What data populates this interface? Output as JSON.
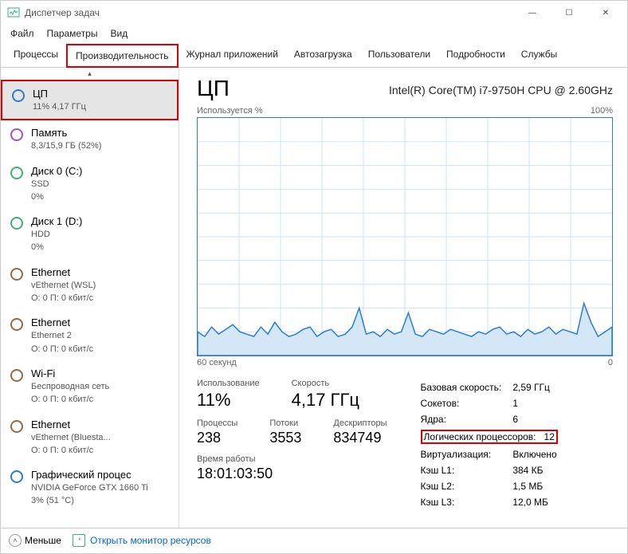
{
  "window": {
    "title": "Диспетчер задач"
  },
  "menu": {
    "file": "Файл",
    "options": "Параметры",
    "view": "Вид"
  },
  "tabs": {
    "processes": "Процессы",
    "performance": "Производительность",
    "apphistory": "Журнал приложений",
    "startup": "Автозагрузка",
    "users": "Пользователи",
    "details": "Подробности",
    "services": "Службы"
  },
  "sidebar": {
    "cpu": {
      "label": "ЦП",
      "sub": "11% 4,17 ГГц"
    },
    "memory": {
      "label": "Память",
      "sub": "8,3/15,9 ГБ (52%)"
    },
    "disk0": {
      "label": "Диск 0 (C:)",
      "sub1": "SSD",
      "sub2": "0%"
    },
    "disk1": {
      "label": "Диск 1 (D:)",
      "sub1": "HDD",
      "sub2": "0%"
    },
    "eth1": {
      "label": "Ethernet",
      "sub1": "vEthernet (WSL)",
      "sub2": "О: 0 П: 0 кбит/с"
    },
    "eth2": {
      "label": "Ethernet",
      "sub1": "Ethernet 2",
      "sub2": "О: 0 П: 0 кбит/с"
    },
    "wifi": {
      "label": "Wi-Fi",
      "sub1": "Беспроводная сеть",
      "sub2": "О: 0 П: 0 кбит/с"
    },
    "eth3": {
      "label": "Ethernet",
      "sub1": "vEthernet (Bluesta...",
      "sub2": "О: 0 П: 0 кбит/с"
    },
    "gpu": {
      "label": "Графический процес",
      "sub1": "NVIDIA GeForce GTX 1660 Ti",
      "sub2": "3% (51 °C)"
    }
  },
  "content": {
    "heading": "ЦП",
    "cpu_name": "Intel(R) Core(TM) i7-9750H CPU @ 2.60GHz",
    "chart_top_left": "Используется %",
    "chart_top_right": "100%",
    "chart_bottom_left": "60 секунд",
    "chart_bottom_right": "0",
    "usage_lbl": "Использование",
    "usage_val": "11%",
    "speed_lbl": "Скорость",
    "speed_val": "4,17 ГГц",
    "processes_lbl": "Процессы",
    "processes_val": "238",
    "threads_lbl": "Потоки",
    "threads_val": "3553",
    "handles_lbl": "Дескрипторы",
    "handles_val": "834749",
    "uptime_lbl": "Время работы",
    "uptime_val": "18:01:03:50",
    "spec": {
      "base_lbl": "Базовая скорость:",
      "base_val": "2,59 ГГц",
      "sockets_lbl": "Сокетов:",
      "sockets_val": "1",
      "cores_lbl": "Ядра:",
      "cores_val": "6",
      "logical_lbl": "Логических процессоров:",
      "logical_val": "12",
      "virt_lbl": "Виртуализация:",
      "virt_val": "Включено",
      "l1_lbl": "Кэш L1:",
      "l1_val": "384 КБ",
      "l2_lbl": "Кэш L2:",
      "l2_val": "1,5 МБ",
      "l3_lbl": "Кэш L3:",
      "l3_val": "12,0 МБ"
    }
  },
  "footer": {
    "less": "Меньше",
    "monitor": "Открыть монитор ресурсов"
  },
  "chart_data": {
    "type": "line",
    "title": "Используется %",
    "xlabel": "60 секунд",
    "ylabel": "%",
    "ylim": [
      0,
      100
    ],
    "x_range_seconds": [
      60,
      0
    ],
    "values": [
      10,
      8,
      12,
      9,
      11,
      13,
      10,
      9,
      8,
      12,
      9,
      14,
      10,
      8,
      9,
      11,
      12,
      8,
      10,
      11,
      8,
      9,
      12,
      20,
      9,
      10,
      8,
      11,
      9,
      10,
      18,
      9,
      8,
      11,
      10,
      9,
      11,
      10,
      9,
      8,
      10,
      9,
      11,
      12,
      9,
      10,
      8,
      11,
      9,
      10,
      12,
      9,
      11,
      10,
      9,
      22,
      14,
      8,
      10,
      12
    ]
  }
}
